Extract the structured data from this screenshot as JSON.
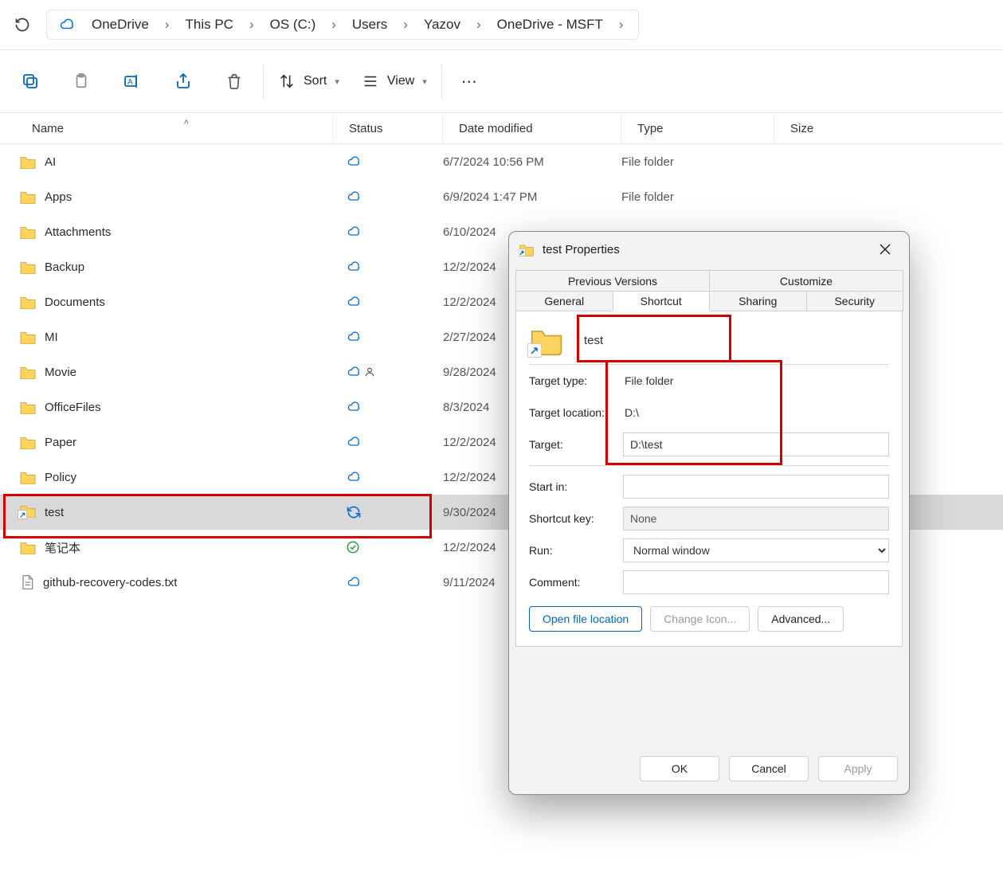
{
  "breadcrumb": {
    "root_icon": "cloud",
    "items": [
      "OneDrive",
      "This PC",
      "OS (C:)",
      "Users",
      "Yazov",
      "OneDrive - MSFT"
    ]
  },
  "toolbar": {
    "sort_label": "Sort",
    "view_label": "View"
  },
  "columns": {
    "name": "Name",
    "status": "Status",
    "date": "Date modified",
    "type": "Type",
    "size": "Size"
  },
  "rows": [
    {
      "icon": "folder",
      "name": "AI",
      "status": "cloud",
      "date": "6/7/2024 10:56 PM",
      "type": "File folder"
    },
    {
      "icon": "folder",
      "name": "Apps",
      "status": "cloud",
      "date": "6/9/2024 1:47 PM",
      "type": "File folder"
    },
    {
      "icon": "folder",
      "name": "Attachments",
      "status": "cloud",
      "date": "6/10/2024",
      "type": ""
    },
    {
      "icon": "folder",
      "name": "Backup",
      "status": "cloud",
      "date": "12/2/2024",
      "type": ""
    },
    {
      "icon": "folder",
      "name": "Documents",
      "status": "cloud",
      "date": "12/2/2024",
      "type": ""
    },
    {
      "icon": "folder",
      "name": "MI",
      "status": "cloud",
      "date": "2/27/2024",
      "type": ""
    },
    {
      "icon": "folder",
      "name": "Movie",
      "status": "cloud_shared",
      "date": "9/28/2024",
      "type": ""
    },
    {
      "icon": "folder",
      "name": "OfficeFiles",
      "status": "cloud",
      "date": "8/3/2024",
      "type": ""
    },
    {
      "icon": "folder",
      "name": "Paper",
      "status": "cloud",
      "date": "12/2/2024",
      "type": ""
    },
    {
      "icon": "folder",
      "name": "Policy",
      "status": "cloud",
      "date": "12/2/2024",
      "type": ""
    },
    {
      "icon": "folder_shortcut",
      "name": "test",
      "status": "sync",
      "date": "9/30/2024",
      "type": "",
      "selected": true
    },
    {
      "icon": "folder",
      "name": "笔记本",
      "status": "check",
      "date": "12/2/2024",
      "type": ""
    },
    {
      "icon": "text",
      "name": "github-recovery-codes.txt",
      "status": "cloud",
      "date": "9/11/2024",
      "type": ""
    }
  ],
  "dialog": {
    "title": "test Properties",
    "tabs_top": [
      "Previous Versions",
      "Customize"
    ],
    "tabs_bottom": [
      "General",
      "Shortcut",
      "Sharing",
      "Security"
    ],
    "active_tab": "Shortcut",
    "name_value": "test",
    "fields": {
      "target_type_label": "Target type:",
      "target_type_value": "File folder",
      "target_location_label": "Target location:",
      "target_location_value": "D:\\",
      "target_label": "Target:",
      "target_value": "D:\\test",
      "start_in_label": "Start in:",
      "start_in_value": "",
      "shortcut_key_label": "Shortcut key:",
      "shortcut_key_value": "None",
      "run_label": "Run:",
      "run_value": "Normal window",
      "comment_label": "Comment:",
      "comment_value": ""
    },
    "buttons": {
      "open_location": "Open file location",
      "change_icon": "Change Icon...",
      "advanced": "Advanced...",
      "ok": "OK",
      "cancel": "Cancel",
      "apply": "Apply"
    }
  }
}
